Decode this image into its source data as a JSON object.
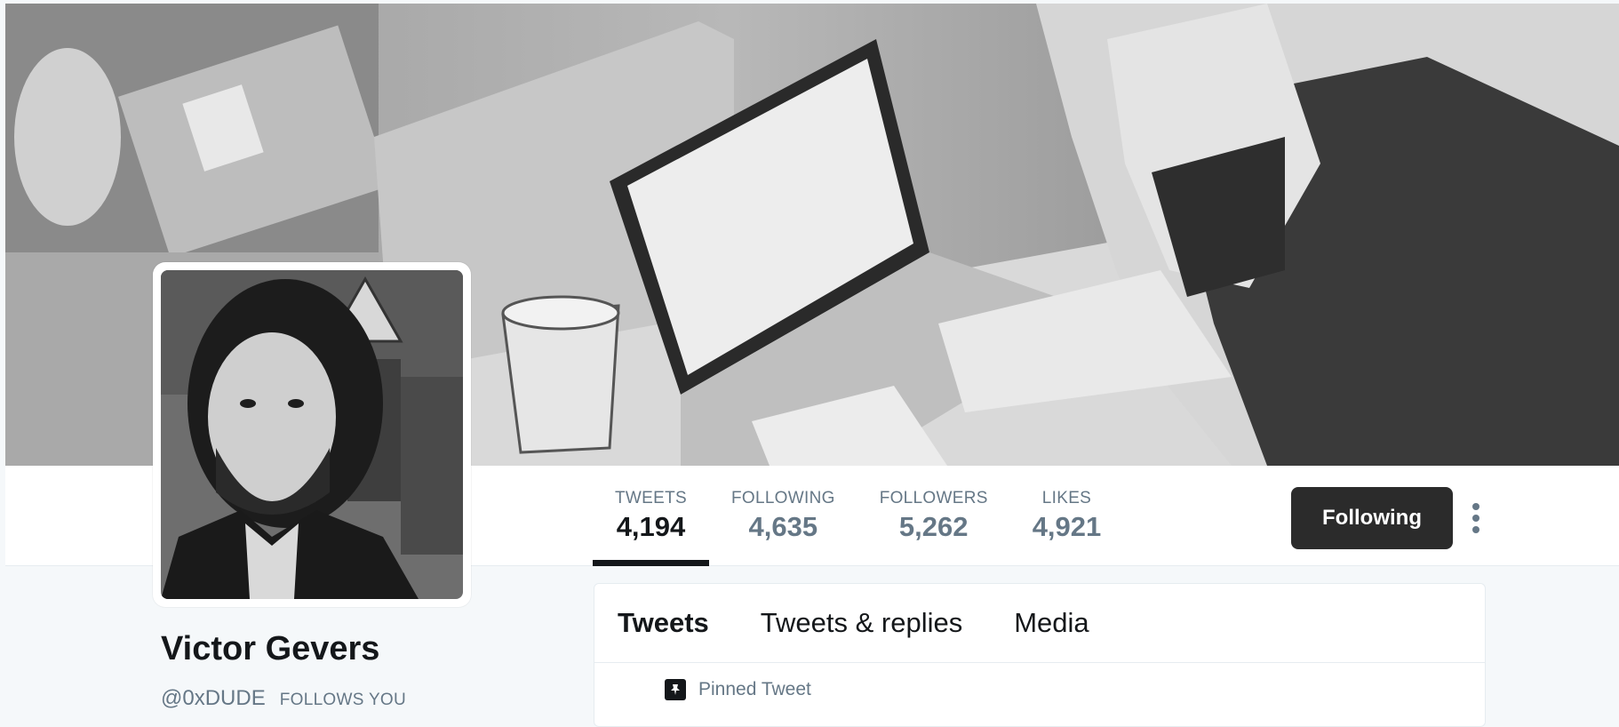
{
  "profile": {
    "name": "Victor Gevers",
    "handle": "@0xDUDE",
    "follows_you": "FOLLOWS YOU"
  },
  "stats": [
    {
      "label": "TWEETS",
      "value": "4,194",
      "active": true
    },
    {
      "label": "FOLLOWING",
      "value": "4,635",
      "active": false
    },
    {
      "label": "FOLLOWERS",
      "value": "5,262",
      "active": false
    },
    {
      "label": "LIKES",
      "value": "4,921",
      "active": false
    }
  ],
  "actions": {
    "following_label": "Following"
  },
  "timeline": {
    "tabs": [
      {
        "label": "Tweets",
        "active": true
      },
      {
        "label": "Tweets & replies",
        "active": false
      },
      {
        "label": "Media",
        "active": false
      }
    ],
    "pinned_label": "Pinned Tweet"
  },
  "colors": {
    "accent_dark": "#14171a",
    "muted": "#657786",
    "button_bg": "#2b2b2b",
    "page_bg": "#f5f8fa"
  }
}
